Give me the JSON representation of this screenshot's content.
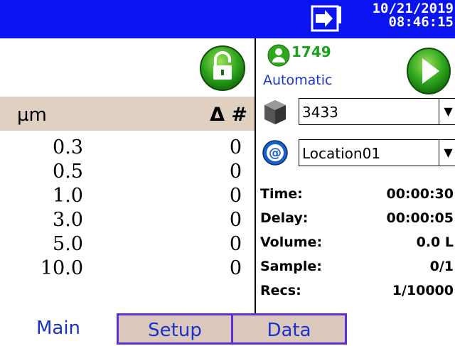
{
  "header": {
    "date": "10/21/2019",
    "time": "08:46:15",
    "exit_icon": "exit-icon"
  },
  "particle_table": {
    "unit_header": "µm",
    "delta_header": "Δ #",
    "rows": [
      {
        "size": "0.3",
        "count": "0"
      },
      {
        "size": "0.5",
        "count": "0"
      },
      {
        "size": "1.0",
        "count": "0"
      },
      {
        "size": "3.0",
        "count": "0"
      },
      {
        "size": "5.0",
        "count": "0"
      },
      {
        "size": "10.0",
        "count": "0"
      }
    ]
  },
  "status": {
    "sample_count": "1749",
    "mode": "Automatic"
  },
  "dropdowns": {
    "instrument": "3433",
    "location": "Location01"
  },
  "stats": [
    {
      "label": "Time:",
      "value": "00:00:30"
    },
    {
      "label": "Delay:",
      "value": "00:00:05"
    },
    {
      "label": "Volume:",
      "value": "0.0 L"
    },
    {
      "label": "Sample:",
      "value": "0/1"
    },
    {
      "label": "Recs:",
      "value": "1/10000"
    }
  ],
  "tabs": {
    "main": "Main",
    "setup": "Setup",
    "data": "Data"
  },
  "colors": {
    "topbar": "#0a14f0",
    "header_bg": "#dfd0c2",
    "green": "#1aa21a",
    "tab_border": "#5b30d8"
  }
}
